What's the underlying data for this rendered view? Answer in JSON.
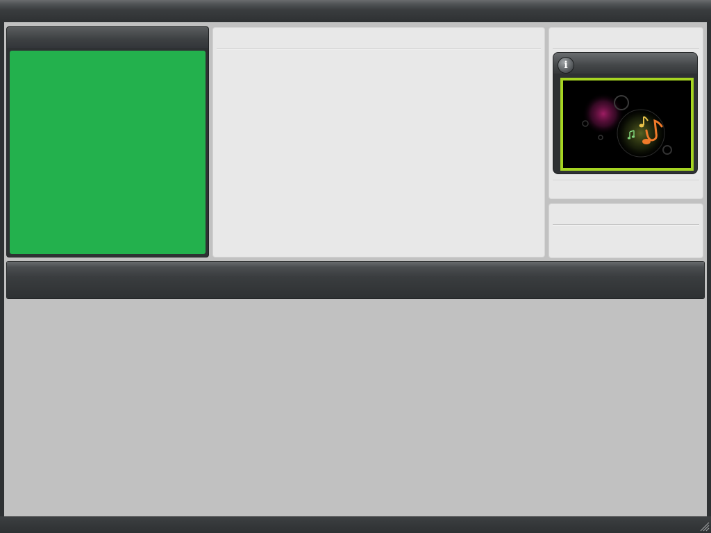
{
  "window": {
    "title": ""
  },
  "player": {
    "video_color": "#23b14d"
  },
  "info_panel": {
    "info_icon_glyph": "i",
    "thumbnail_icon": "music-notes-image",
    "thumbnail_border_color": "#a6d522"
  },
  "theme": {
    "dark": "#2e3133",
    "light": "#e8e8e8",
    "background": "#c1c1c1"
  }
}
